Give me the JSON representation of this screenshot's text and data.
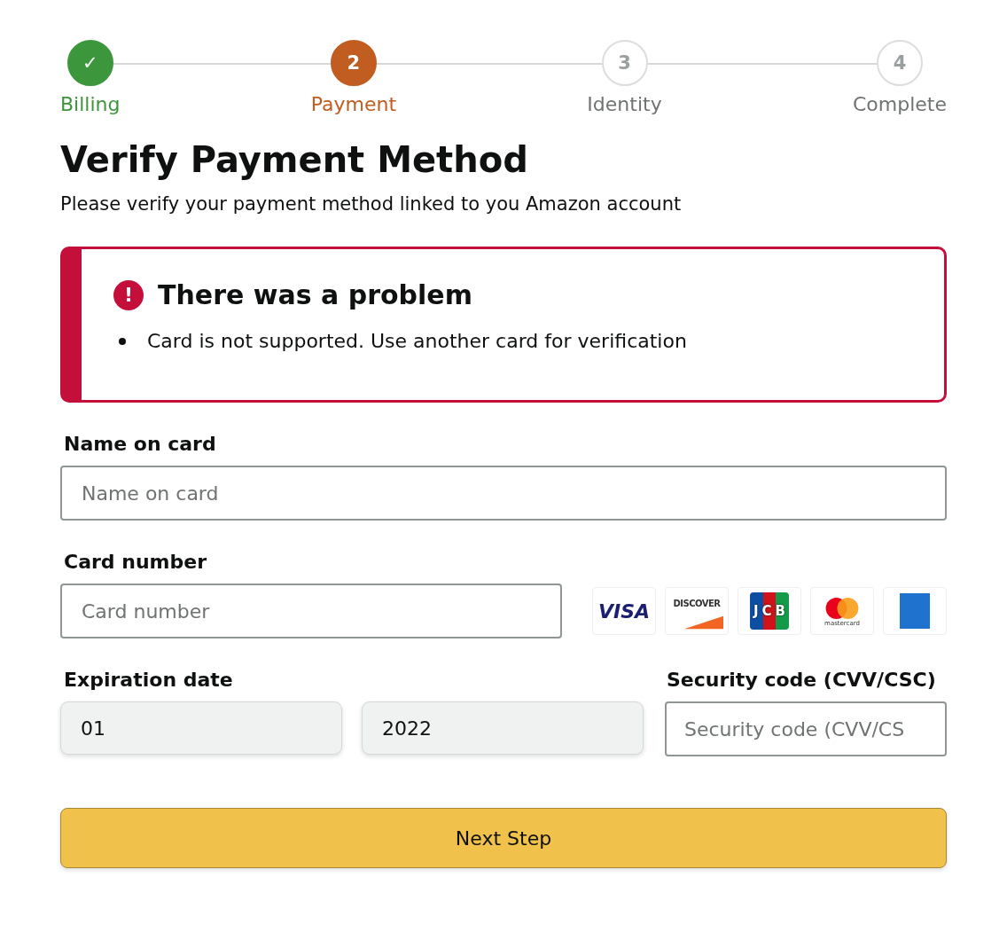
{
  "steps": [
    {
      "label": "Billing",
      "number": "✓",
      "kind": "done"
    },
    {
      "label": "Payment",
      "number": "2",
      "kind": "current"
    },
    {
      "label": "Identity",
      "number": "3",
      "kind": "upcoming"
    },
    {
      "label": "Complete",
      "number": "4",
      "kind": "upcoming"
    }
  ],
  "title": "Verify Payment Method",
  "subtitle": "Please verify your payment method linked to you Amazon account",
  "alert": {
    "icon": "!",
    "title": "There was a problem",
    "messages": [
      "Card is not supported. Use another card for verification"
    ]
  },
  "name_field": {
    "label": "Name on card",
    "placeholder": "Name on card"
  },
  "card_field": {
    "label": "Card number",
    "placeholder": "Card number"
  },
  "card_logos": [
    {
      "kind": "visa",
      "text": "VISA"
    },
    {
      "kind": "discover",
      "text": "DISCOVER"
    },
    {
      "kind": "jcb",
      "text": "JCB"
    },
    {
      "kind": "mastercard",
      "text": "mastercard"
    },
    {
      "kind": "amex"
    }
  ],
  "expiration": {
    "label": "Expiration date",
    "month": "01",
    "year": "2022"
  },
  "security_field": {
    "label": "Security code (CVV/CSC)",
    "placeholder": "Security code (CVV/CS"
  },
  "button": "Next Step"
}
